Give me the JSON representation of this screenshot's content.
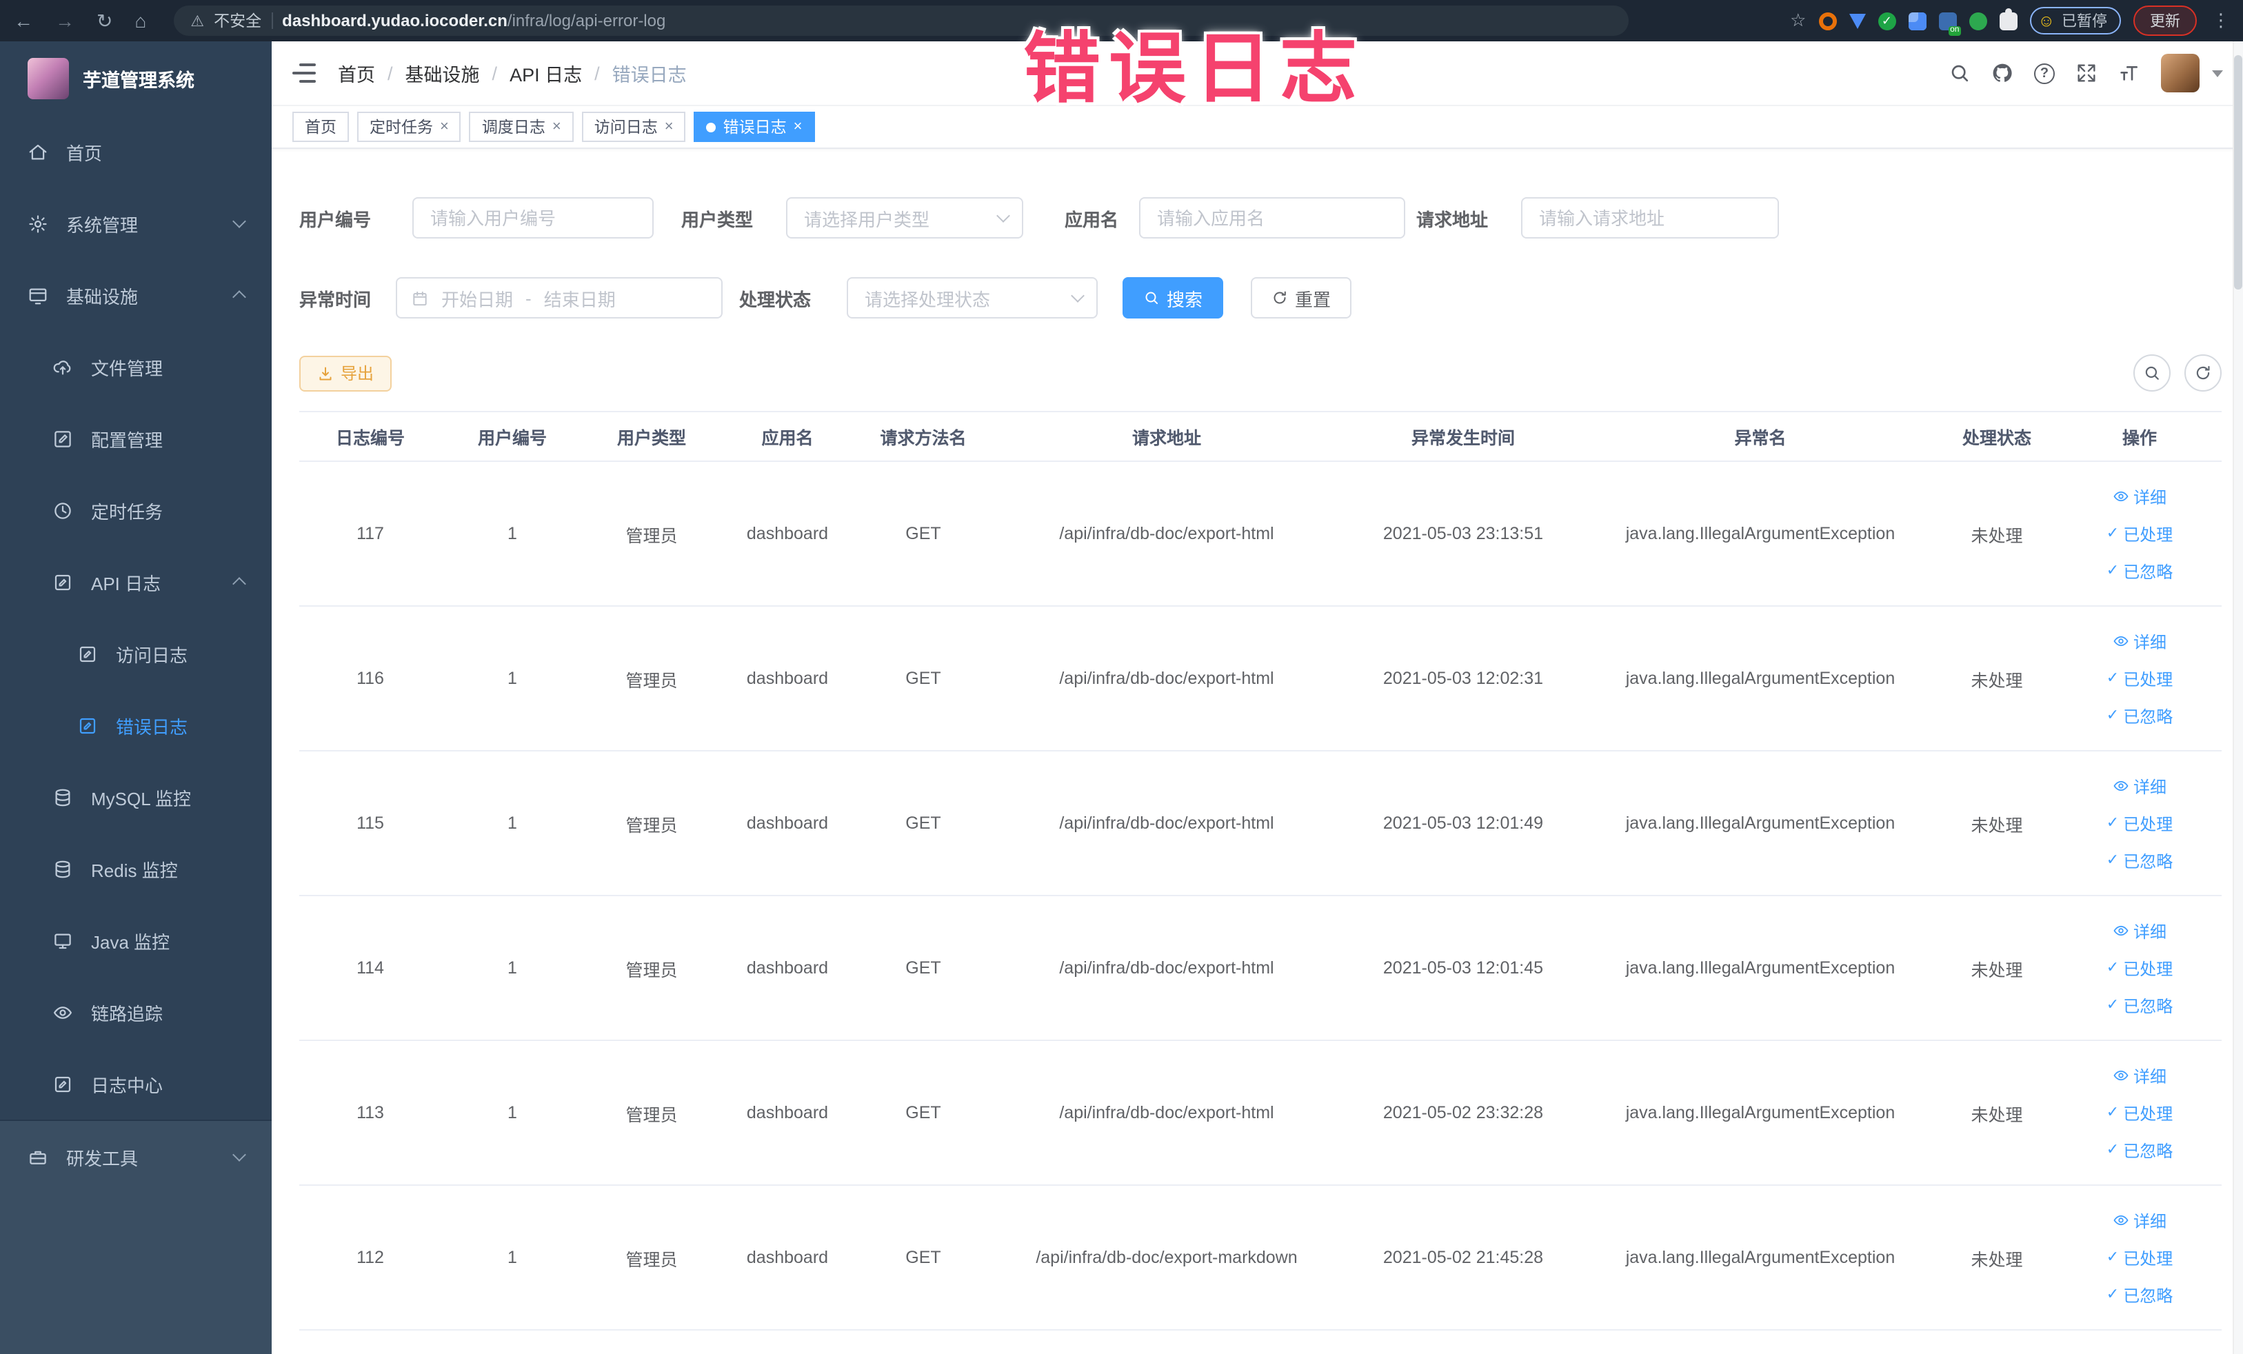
{
  "overlay": {
    "text": "错误日志"
  },
  "colors": {
    "accent": "#409eff",
    "warning": "#e6a23c",
    "overlay_pink": "#f5426e",
    "sidebar_bg": "#2e4156",
    "browser_bar_bg": "#1d2734",
    "update_badge_red": "#d93025"
  },
  "browser": {
    "nav_icons": [
      "back-arrow",
      "forward-arrow",
      "reload",
      "home"
    ],
    "back_glyph": "←",
    "forward_glyph": "→",
    "reload_glyph": "↻",
    "home_glyph": "⌂",
    "warning_glyph": "⚠",
    "security_label": "不安全",
    "url_domain": "dashboard.yudao.iocoder.cn",
    "url_path": "/infra/log/api-error-log",
    "star_glyph": "☆",
    "extension_icons": [
      "bookmark-star",
      "extension-orange-ring",
      "extension-blue-shield",
      "extension-green-check",
      "extension-blue-grid",
      "extension-on-badge",
      "extension-green-leaf",
      "extensions-puzzle"
    ],
    "paused_smiley_glyph": "☺",
    "paused_chip": "已暂停",
    "update_button": "更新",
    "kebab_glyph": "⋮"
  },
  "sidebar": {
    "title": "芋道管理系统",
    "items": [
      {
        "label": "首页",
        "icon": "home-icon"
      },
      {
        "label": "系统管理",
        "icon": "gear-icon",
        "chevron": "down"
      },
      {
        "label": "基础设施",
        "icon": "infra-icon",
        "chevron": "up"
      },
      {
        "label": "文件管理",
        "icon": "cloud-upload-icon"
      },
      {
        "label": "配置管理",
        "icon": "edit-icon"
      },
      {
        "label": "定时任务",
        "icon": "clock-icon"
      },
      {
        "label": "API 日志",
        "icon": "log-icon",
        "chevron": "up"
      },
      {
        "label": "访问日志",
        "icon": "doc-edit-icon"
      },
      {
        "label": "错误日志",
        "icon": "doc-edit-icon",
        "active": true
      },
      {
        "label": "MySQL 监控",
        "icon": "database-icon"
      },
      {
        "label": "Redis 监控",
        "icon": "database-icon"
      },
      {
        "label": "Java 监控",
        "icon": "monitor-icon"
      },
      {
        "label": "链路追踪",
        "icon": "eye-icon"
      },
      {
        "label": "日志中心",
        "icon": "doc-edit-icon"
      },
      {
        "label": "研发工具",
        "icon": "toolbox-icon",
        "chevron": "down"
      }
    ]
  },
  "navbar": {
    "breadcrumb": [
      "首页",
      "基础设施",
      "API 日志",
      "错误日志"
    ],
    "breadcrumb_separator": "/",
    "tool_icons": [
      "search-icon",
      "github-icon",
      "help-icon",
      "fullscreen-icon",
      "font-size-icon",
      "avatar",
      "caret-down-icon"
    ]
  },
  "tags": [
    {
      "label": "首页"
    },
    {
      "label": "定时任务"
    },
    {
      "label": "调度日志"
    },
    {
      "label": "访问日志"
    },
    {
      "label": "错误日志"
    }
  ],
  "filters": {
    "user_id_label": "用户编号",
    "user_id_placeholder": "请输入用户编号",
    "user_type_label": "用户类型",
    "user_type_placeholder": "请选择用户类型",
    "app_name_label": "应用名",
    "app_name_placeholder": "请输入应用名",
    "request_url_label": "请求地址",
    "request_url_placeholder": "请输入请求地址",
    "exception_time_label": "异常时间",
    "date_start_placeholder": "开始日期",
    "date_separator": "-",
    "date_end_placeholder": "结束日期",
    "process_status_label": "处理状态",
    "process_status_placeholder": "请选择处理状态",
    "search_label": "搜索",
    "reset_label": "重置"
  },
  "toolbar": {
    "export_label": "导出"
  },
  "table": {
    "columns": [
      "日志编号",
      "用户编号",
      "用户类型",
      "应用名",
      "请求方法名",
      "请求地址",
      "异常发生时间",
      "异常名",
      "处理状态",
      "操作"
    ],
    "action_labels": [
      "详细",
      "已处理",
      "已忽略"
    ],
    "check_glyph": "✓",
    "rows": [
      {
        "id": "117",
        "user_id": "1",
        "user_type": "管理员",
        "app": "dashboard",
        "method": "GET",
        "url": "/api/infra/db-doc/export-html",
        "time": "2021-05-03 23:13:51",
        "exception": "java.lang.IllegalArgumentException",
        "status": "未处理"
      },
      {
        "id": "116",
        "user_id": "1",
        "user_type": "管理员",
        "app": "dashboard",
        "method": "GET",
        "url": "/api/infra/db-doc/export-html",
        "time": "2021-05-03 12:02:31",
        "exception": "java.lang.IllegalArgumentException",
        "status": "未处理"
      },
      {
        "id": "115",
        "user_id": "1",
        "user_type": "管理员",
        "app": "dashboard",
        "method": "GET",
        "url": "/api/infra/db-doc/export-html",
        "time": "2021-05-03 12:01:49",
        "exception": "java.lang.IllegalArgumentException",
        "status": "未处理"
      },
      {
        "id": "114",
        "user_id": "1",
        "user_type": "管理员",
        "app": "dashboard",
        "method": "GET",
        "url": "/api/infra/db-doc/export-html",
        "time": "2021-05-03 12:01:45",
        "exception": "java.lang.IllegalArgumentException",
        "status": "未处理"
      },
      {
        "id": "113",
        "user_id": "1",
        "user_type": "管理员",
        "app": "dashboard",
        "method": "GET",
        "url": "/api/infra/db-doc/export-html",
        "time": "2021-05-02 23:32:28",
        "exception": "java.lang.IllegalArgumentException",
        "status": "未处理"
      },
      {
        "id": "112",
        "user_id": "1",
        "user_type": "管理员",
        "app": "dashboard",
        "method": "GET",
        "url": "/api/infra/db-doc/export-markdown",
        "time": "2021-05-02 21:45:28",
        "exception": "java.lang.IllegalArgumentException",
        "status": "未处理"
      }
    ]
  }
}
